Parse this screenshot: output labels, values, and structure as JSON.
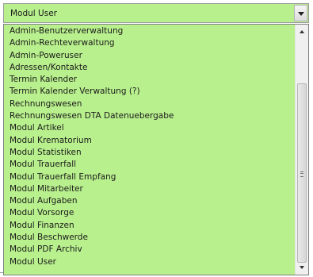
{
  "combo": {
    "value": "Modul User",
    "dropdown_icon": "chevron-down-icon"
  },
  "dropdown": {
    "selected_index": 20,
    "options": [
      {
        "label": "Admin-Benutzerverwaltung"
      },
      {
        "label": "Admin-Rechteverwaltung"
      },
      {
        "label": "Admin-Poweruser"
      },
      {
        "label": "Adressen/Kontakte"
      },
      {
        "label": "Termin Kalender"
      },
      {
        "label": "Termin Kalender Verwaltung (?)"
      },
      {
        "label": "Rechnungswesen"
      },
      {
        "label": "Rechnungswesen DTA Datenuebergabe"
      },
      {
        "label": "Modul Artikel"
      },
      {
        "label": "Modul Krematorium"
      },
      {
        "label": "Modul Statistiken"
      },
      {
        "label": "Modul Trauerfall"
      },
      {
        "label": "Modul Trauerfall Empfang"
      },
      {
        "label": "Modul Mitarbeiter"
      },
      {
        "label": "Modul Aufgaben"
      },
      {
        "label": "Modul Vorsorge"
      },
      {
        "label": "Modul Finanzen"
      },
      {
        "label": "Modul Beschwerde"
      },
      {
        "label": "Modul PDF Archiv"
      },
      {
        "label": "Modul User"
      }
    ]
  },
  "colors": {
    "field_background": "#b9f08e",
    "selection_background": "#3d8ee6",
    "selection_text": "#ffffff"
  }
}
